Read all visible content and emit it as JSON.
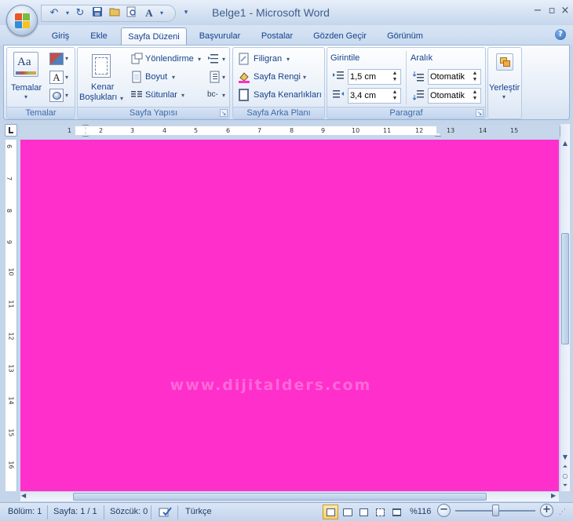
{
  "window": {
    "title": "Belge1 - Microsoft Word"
  },
  "qat": {
    "icons": [
      "undo-icon",
      "redo-icon",
      "save-icon",
      "open-icon",
      "print-preview-icon",
      "spelling-icon",
      "customize-icon"
    ]
  },
  "tabs": [
    {
      "label": "Giriş"
    },
    {
      "label": "Ekle"
    },
    {
      "label": "Sayfa Düzeni"
    },
    {
      "label": "Başvurular"
    },
    {
      "label": "Postalar"
    },
    {
      "label": "Gözden Geçir"
    },
    {
      "label": "Görünüm"
    }
  ],
  "ribbon": {
    "temalar": {
      "label": "Temalar",
      "button": "Temalar",
      "icon_letters": "Aa",
      "fonts_icon_letter": "A"
    },
    "sayfa_yapisi": {
      "label": "Sayfa Yapısı",
      "margins_line1": "Kenar",
      "margins_line2": "Boşlukları",
      "orientation": "Yönlendirme",
      "size": "Boyut",
      "columns": "Sütunlar",
      "hyphenation_glyph": "bc-"
    },
    "sayfa_arka_plani": {
      "label": "Sayfa Arka Planı",
      "watermark": "Filigran",
      "page_color": "Sayfa Rengi",
      "page_borders": "Sayfa Kenarlıkları"
    },
    "paragraf": {
      "label": "Paragraf",
      "indent_title": "Girintile",
      "indent_left": "1,5 cm",
      "indent_right": "3,4 cm",
      "spacing_title": "Aralık",
      "spacing_before": "Otomatik",
      "spacing_after": "Otomatik"
    },
    "yerlestir": {
      "label": "Yerleştir"
    }
  },
  "hruler": {
    "ticks": [
      "1",
      "2",
      "3",
      "4",
      "5",
      "6",
      "7",
      "8",
      "9",
      "10",
      "11",
      "12",
      "13",
      "14",
      "15"
    ]
  },
  "vruler": {
    "ticks": [
      "6",
      "7",
      "8",
      "9",
      "10",
      "11",
      "12",
      "13",
      "14",
      "15",
      "16"
    ]
  },
  "document": {
    "background": "#ff2fcb",
    "watermark": "www.dijitalders.com"
  },
  "status": {
    "section": "Bölüm: 1",
    "page": "Sayfa: 1 / 1",
    "words": "Sözcük: 0",
    "language": "Türkçe",
    "zoom": "%116",
    "zoom_fraction": 0.5
  }
}
